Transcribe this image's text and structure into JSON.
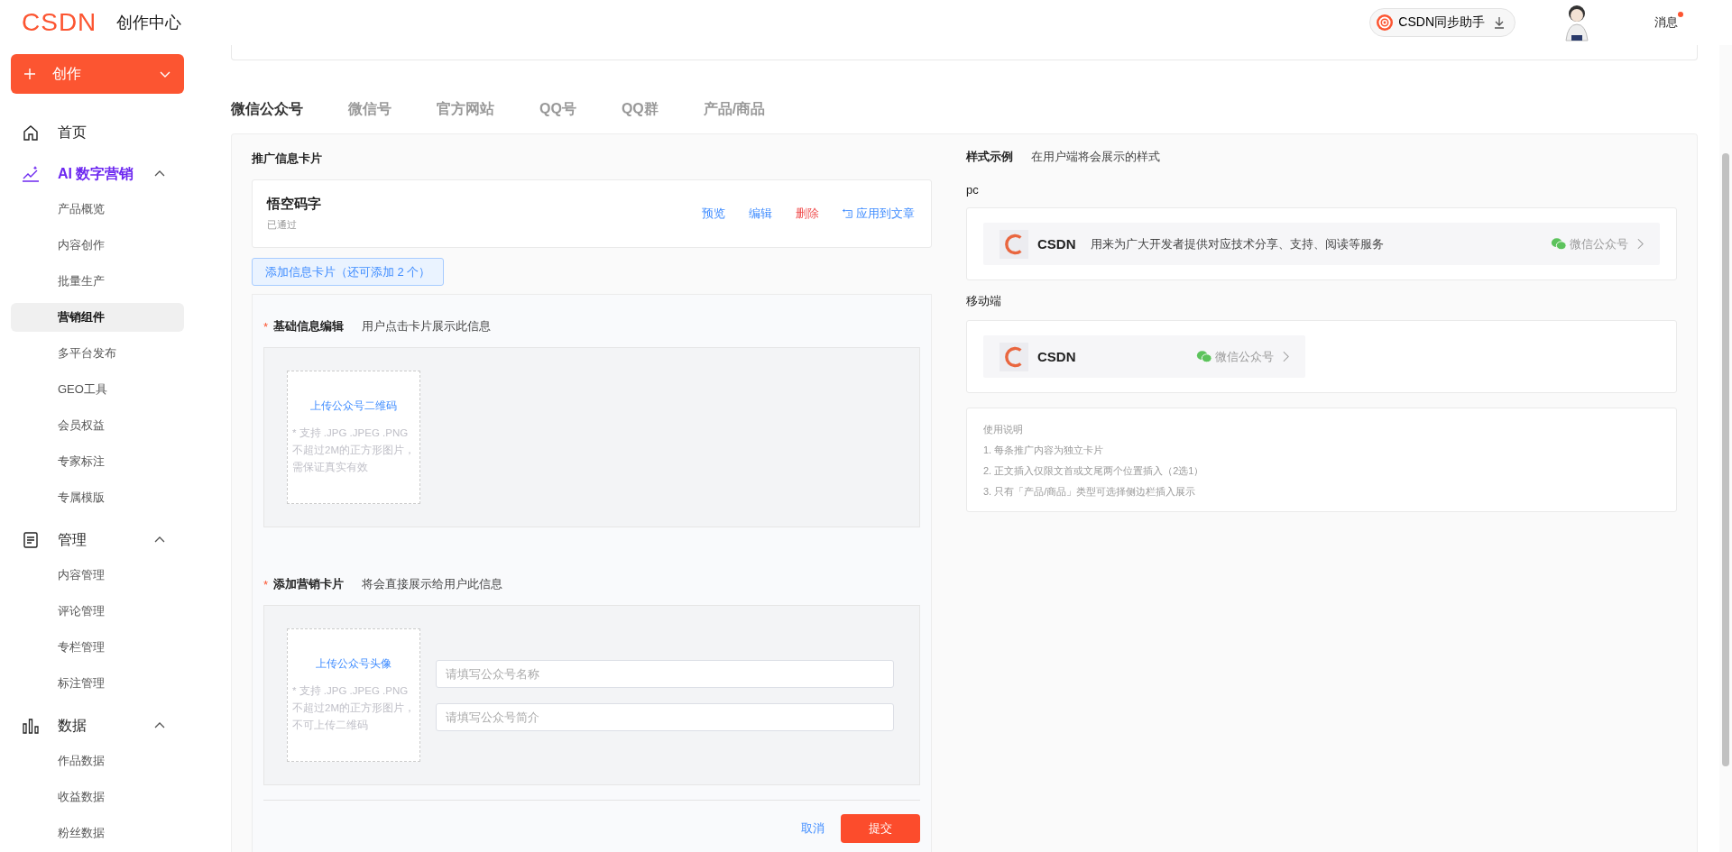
{
  "header": {
    "logo": "CSDN",
    "title": "创作中心",
    "assistant": "CSDN同步助手",
    "messages": {
      "label": "消息",
      "unread": true
    }
  },
  "sidebar": {
    "create_button": "创作",
    "nav": [
      {
        "label": "首页",
        "highlighted": false
      },
      {
        "label": "AI 数字营销",
        "highlighted": true,
        "expanded": true,
        "children": [
          {
            "label": "产品概览",
            "selected": false
          },
          {
            "label": "内容创作",
            "selected": false
          },
          {
            "label": "批量生产",
            "selected": false
          },
          {
            "label": "营销组件",
            "selected": true
          },
          {
            "label": "多平台发布",
            "selected": false
          },
          {
            "label": "GEO工具",
            "selected": false
          },
          {
            "label": "会员权益",
            "selected": false
          },
          {
            "label": "专家标注",
            "selected": false
          },
          {
            "label": "专属模版",
            "selected": false
          }
        ]
      },
      {
        "label": "管理",
        "highlighted": false,
        "expanded": true,
        "children": [
          {
            "label": "内容管理",
            "selected": false
          },
          {
            "label": "评论管理",
            "selected": false
          },
          {
            "label": "专栏管理",
            "selected": false
          },
          {
            "label": "标注管理",
            "selected": false
          }
        ]
      },
      {
        "label": "数据",
        "highlighted": false,
        "expanded": true,
        "children": [
          {
            "label": "作品数据",
            "selected": false
          },
          {
            "label": "收益数据",
            "selected": false
          },
          {
            "label": "粉丝数据",
            "selected": false
          }
        ]
      }
    ]
  },
  "tabs": [
    {
      "label": "微信公众号",
      "selected": true
    },
    {
      "label": "微信号",
      "selected": false
    },
    {
      "label": "官方网站",
      "selected": false
    },
    {
      "label": "QQ号",
      "selected": false
    },
    {
      "label": "QQ群",
      "selected": false
    },
    {
      "label": "产品/商品",
      "selected": false
    }
  ],
  "promo": {
    "title": "推广信息卡片",
    "card": {
      "name": "悟空码字",
      "status": "已通过",
      "actions": [
        {
          "label": "预览",
          "kind": "link"
        },
        {
          "label": "编辑",
          "kind": "link"
        },
        {
          "label": "删除",
          "kind": "danger"
        },
        {
          "label": "应用到文章",
          "kind": "apply"
        }
      ]
    },
    "add_button": "添加信息卡片（还可添加 2 个）",
    "basic": {
      "required_mark": "*",
      "title": "基础信息编辑",
      "hint": "用户点击卡片展示此信息",
      "upload": {
        "label": "上传公众号二维码",
        "note": "* 支持 .JPG .JPEG .PNG 不超过2M的正方形图片，需保证真实有效"
      }
    },
    "marketing": {
      "required_mark": "*",
      "title": "添加营销卡片",
      "hint": "将会直接展示给用户此信息",
      "upload": {
        "label": "上传公众号头像",
        "note": "* 支持 .JPG .JPEG .PNG 不超过2M的正方形图片，不可上传二维码"
      },
      "fields": [
        {
          "placeholder": "请填写公众号名称"
        },
        {
          "placeholder": "请填写公众号简介"
        }
      ]
    },
    "cancel": "取消",
    "submit": "提交"
  },
  "preview": {
    "title": "样式示例",
    "hint": "在用户端将会展示的样式",
    "pc": {
      "label": "pc",
      "name": "CSDN",
      "desc": "用来为广大开发者提供对应技术分享、支持、阅读等服务",
      "channel": "微信公众号"
    },
    "mobile": {
      "label": "移动端",
      "name": "CSDN",
      "channel": "微信公众号"
    },
    "notes": {
      "title": "使用说明",
      "items": [
        "1. 每条推广内容为独立卡片",
        "2. 正文插入仅限文首或文尾两个位置插入（2选1）",
        "3. 只有「产品/商品」类型可选择侧边栏插入展示"
      ]
    }
  }
}
